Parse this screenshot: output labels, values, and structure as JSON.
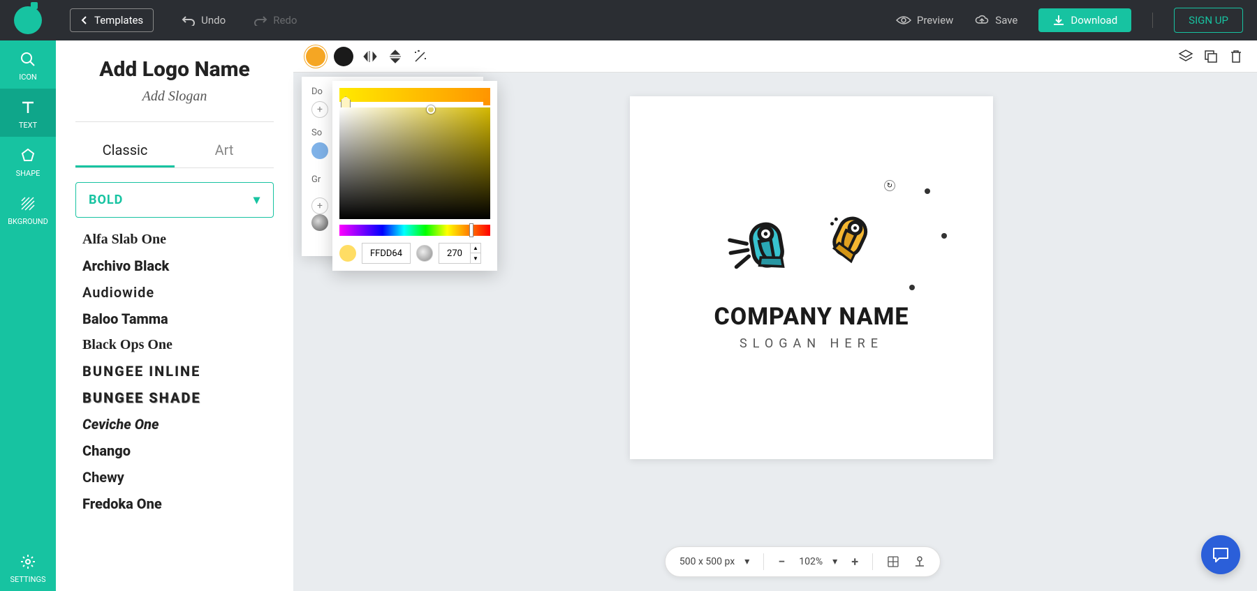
{
  "topbar": {
    "templates": "Templates",
    "undo": "Undo",
    "redo": "Redo",
    "preview": "Preview",
    "save": "Save",
    "download": "Download",
    "signup": "SIGN UP"
  },
  "rail": {
    "icon": "ICON",
    "text": "TEXT",
    "shape": "SHAPE",
    "bkground": "BKGROUND",
    "settings": "SETTINGS"
  },
  "sidebar": {
    "title": "Add Logo Name",
    "subtitle": "Add Slogan",
    "tabs": {
      "classic": "Classic",
      "art": "Art"
    },
    "select": "BOLD",
    "fonts": [
      "Alfa Slab One",
      "Archivo Black",
      "Audiowide",
      "Baloo Tamma",
      "Black Ops One",
      "BUNGEE INLINE",
      "BUNGEE SHADE",
      "Ceviche One",
      "Chango",
      "Chewy",
      "Fredoka One"
    ]
  },
  "color_popup": {
    "doc_label": "Do",
    "solid_label": "So",
    "grad_label": "Gr",
    "solid_swatches": [
      "#7fb2e8",
      "#3a7bd5",
      "#2b5fd9",
      "#ffffff"
    ],
    "grad_swatches": [
      "#ff3b6b",
      "#3cc24c",
      "#f5a623",
      "#b26a2e",
      "#36c6e8"
    ],
    "grey_swatch": "#8a8a8a"
  },
  "picker": {
    "hex": "FFDD64",
    "angle": "270"
  },
  "canvas": {
    "company": "COMPANY NAME",
    "slogan": "SLOGAN HERE"
  },
  "zoom": {
    "size": "500 x 500 px",
    "level": "102%"
  }
}
